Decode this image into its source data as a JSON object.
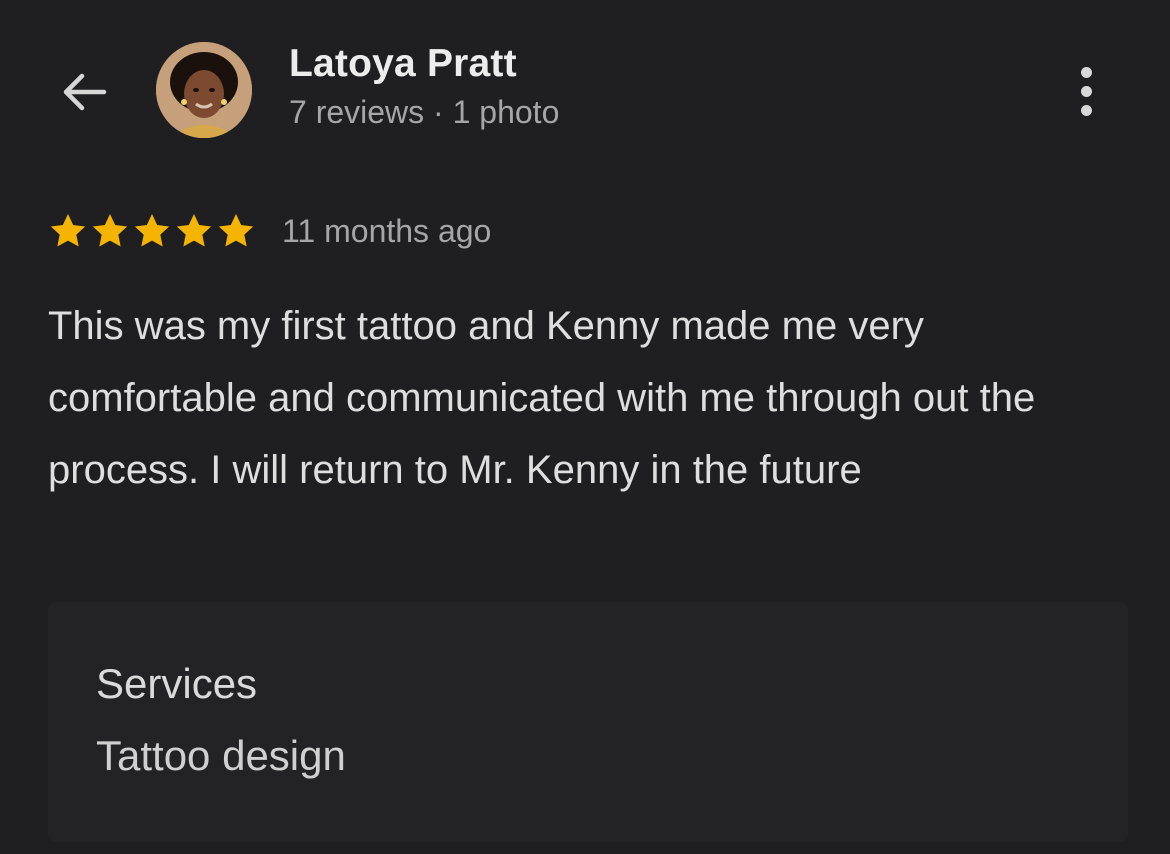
{
  "header": {
    "back_icon": "arrow-left-icon",
    "reviewer_name": "Latoya Pratt",
    "reviewer_meta": "7 reviews · 1 photo",
    "more_icon": "more-vertical-icon"
  },
  "review": {
    "rating": 5,
    "rating_max": 5,
    "star_color": "#f4b400",
    "time_ago": "11 months ago",
    "text": "This was my first tattoo and Kenny made me very comfortable and communicated with me through out the process. I will return to Mr. Kenny in the future"
  },
  "services": {
    "title": "Services",
    "value": "Tattoo design"
  }
}
